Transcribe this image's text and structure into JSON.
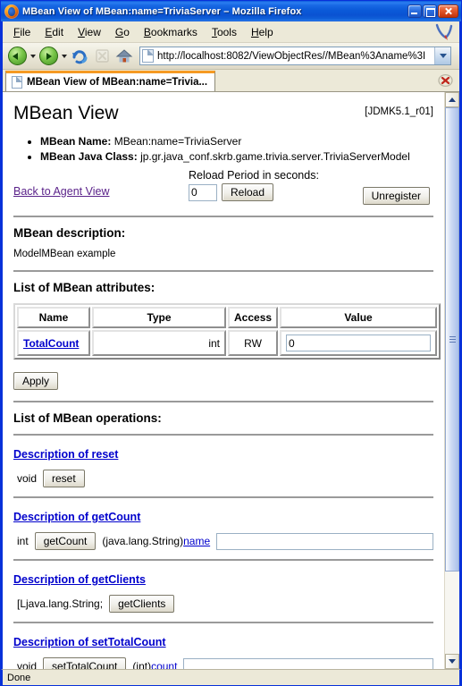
{
  "window": {
    "title": "MBean View of MBean:name=TriviaServer – Mozilla Firefox",
    "minimize_label": "Minimize",
    "maximize_label": "Maximize",
    "close_label": "Close"
  },
  "menubar": [
    {
      "label": "File",
      "accel": "F"
    },
    {
      "label": "Edit",
      "accel": "E"
    },
    {
      "label": "View",
      "accel": "V"
    },
    {
      "label": "Go",
      "accel": "G"
    },
    {
      "label": "Bookmarks",
      "accel": "B"
    },
    {
      "label": "Tools",
      "accel": "T"
    },
    {
      "label": "Help",
      "accel": "H"
    }
  ],
  "toolbar": {
    "back_tooltip": "Back",
    "forward_tooltip": "Forward",
    "reload_tooltip": "Reload",
    "stop_tooltip": "Stop",
    "home_tooltip": "Home",
    "url": "http://localhost:8082/ViewObjectRes//MBean%3Aname%3I"
  },
  "tab": {
    "label": "MBean View of MBean:name=Trivia...",
    "close_label": "Close tab"
  },
  "statusbar": {
    "text": "Done"
  },
  "page": {
    "title": "MBean View",
    "version": "[JDMK5.1_r01]",
    "info": [
      {
        "label": "MBean Name:",
        "value": "MBean:name=TriviaServer"
      },
      {
        "label": "MBean Java Class:",
        "value": "jp.gr.java_conf.skrb.game.trivia.server.TriviaServerModel"
      }
    ],
    "back_link": "Back to Agent View",
    "reload_label": "Reload Period in seconds:",
    "reload_value": "0",
    "reload_button": "Reload",
    "unregister_button": "Unregister",
    "description_heading": "MBean description:",
    "description_text": "ModelMBean example",
    "attributes_heading": "List of MBean attributes:",
    "attributes_table": {
      "columns": [
        "Name",
        "Type",
        "Access",
        "Value"
      ],
      "rows": [
        {
          "name": "TotalCount",
          "type": "int",
          "access": "RW",
          "value": "0"
        }
      ]
    },
    "apply_button": "Apply",
    "operations_heading": "List of MBean operations:",
    "operations": [
      {
        "title": "Description of reset",
        "return_type": "void",
        "button": "reset",
        "param_type": "",
        "param_name": "",
        "has_input": false,
        "input_value": ""
      },
      {
        "title": "Description of getCount",
        "return_type": "int",
        "button": "getCount",
        "param_type": "(java.lang.String)",
        "param_name": "name",
        "has_input": true,
        "input_value": ""
      },
      {
        "title": "Description of getClients",
        "return_type": "[Ljava.lang.String;",
        "button": "getClients",
        "param_type": "",
        "param_name": "",
        "has_input": false,
        "input_value": ""
      },
      {
        "title": "Description of setTotalCount",
        "return_type": "void",
        "button": "setTotalCount",
        "param_type": "(int)",
        "param_name": "count",
        "has_input": true,
        "input_value": ""
      }
    ]
  },
  "colors": {
    "titlebar_blue": "#0a52d2",
    "chrome": "#ece9d8",
    "link_blue": "#0000cc",
    "visited_purple": "#5b238a",
    "tab_accent": "#f59a23"
  }
}
